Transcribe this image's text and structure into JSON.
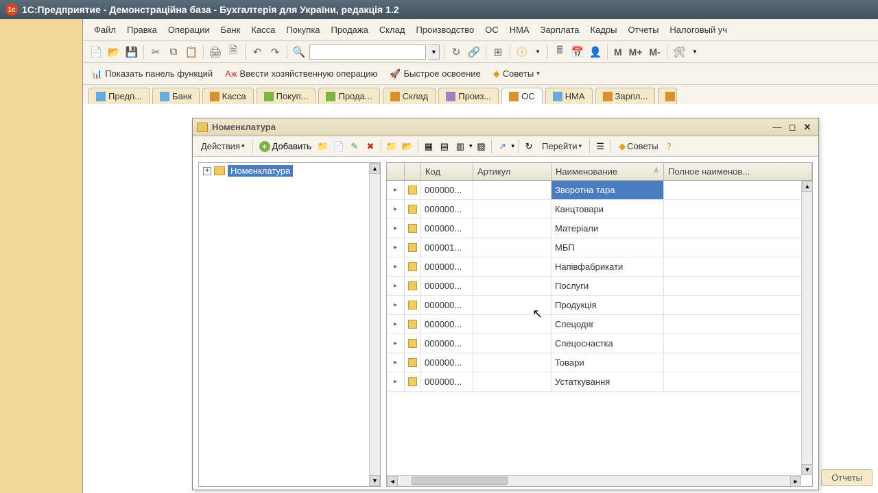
{
  "titlebar": {
    "text": "1С:Предприятие - Демонстраційна база - Бухгалтерія для України, редакція 1.2"
  },
  "menubar": {
    "items": [
      "Файл",
      "Правка",
      "Операции",
      "Банк",
      "Касса",
      "Покупка",
      "Продажа",
      "Склад",
      "Производство",
      "ОС",
      "НМА",
      "Зарплата",
      "Кадры",
      "Отчеты",
      "Налоговый уч"
    ]
  },
  "toolbar1": {
    "m_labels": [
      "М",
      "М+",
      "М-"
    ]
  },
  "toolbar2": {
    "show_panel": "Показать панель функций",
    "enter_op": "Ввести хозяйственную операцию",
    "quick": "Быстрое освоение",
    "tips": "Советы"
  },
  "tabs": [
    {
      "label": "Предп...",
      "color": "#6aa8e0"
    },
    {
      "label": "Банк",
      "color": "#6aa8e0"
    },
    {
      "label": "Касса",
      "color": "#d89030"
    },
    {
      "label": "Покуп...",
      "color": "#7cb342"
    },
    {
      "label": "Прода...",
      "color": "#7cb342"
    },
    {
      "label": "Склад",
      "color": "#d89030"
    },
    {
      "label": "Произ...",
      "color": "#a080c0"
    },
    {
      "label": "ОС",
      "color": "#d89030",
      "active": true
    },
    {
      "label": "НМА",
      "color": "#6aa8e0"
    },
    {
      "label": "Зарпл...",
      "color": "#d89030"
    }
  ],
  "subwindow": {
    "title": "Номенклатура",
    "toolbar": {
      "actions": "Действия",
      "add": "Добавить",
      "go": "Перейти",
      "tips": "Советы"
    },
    "tree": {
      "root": "Номенклатура"
    },
    "grid": {
      "headers": {
        "code": "Код",
        "article": "Артикул",
        "name": "Наименование",
        "fullname": "Полное наименов..."
      },
      "rows": [
        {
          "code": "000000...",
          "article": "",
          "name": "Зворотна тара",
          "selected": true
        },
        {
          "code": "000000...",
          "article": "",
          "name": "Канцтовари"
        },
        {
          "code": "000000...",
          "article": "",
          "name": "Матеріали"
        },
        {
          "code": "000001...",
          "article": "",
          "name": "МБП"
        },
        {
          "code": "000000...",
          "article": "",
          "name": "Напівфабрикати"
        },
        {
          "code": "000000...",
          "article": "",
          "name": "Послуги"
        },
        {
          "code": "000000...",
          "article": "",
          "name": "Продукція"
        },
        {
          "code": "000000...",
          "article": "",
          "name": "Спецодяг"
        },
        {
          "code": "000000...",
          "article": "",
          "name": "Спецоснастка"
        },
        {
          "code": "000000...",
          "article": "",
          "name": "Товари"
        },
        {
          "code": "000000...",
          "article": "",
          "name": "Устаткування"
        }
      ]
    }
  },
  "bottom_tab": "Отчеты"
}
